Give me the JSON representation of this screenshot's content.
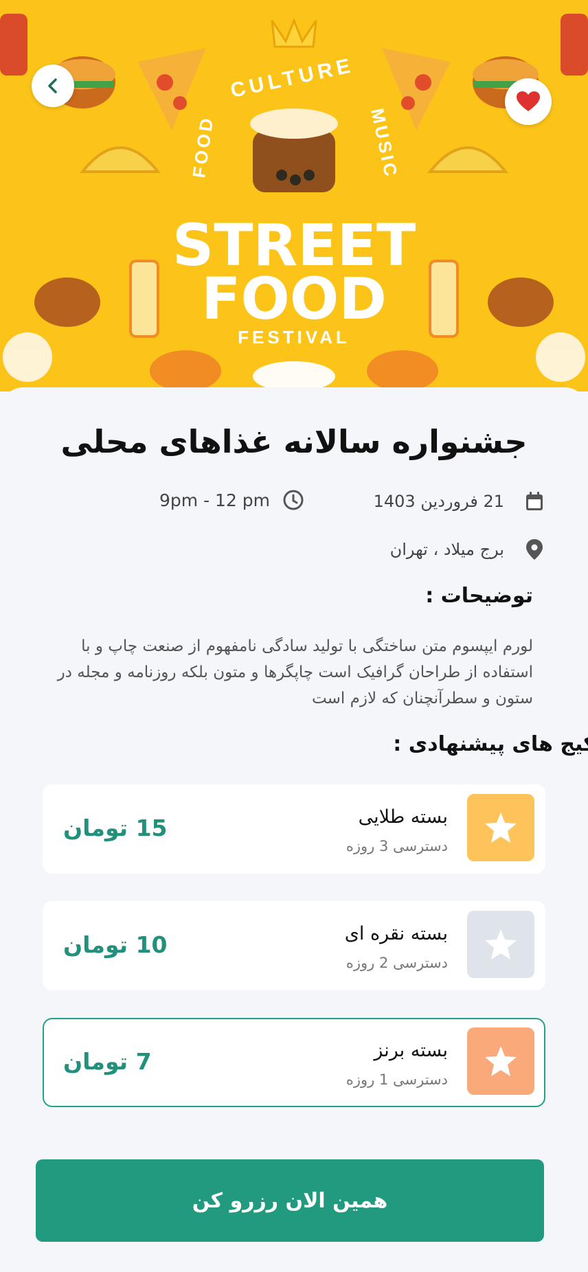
{
  "hero": {
    "banner_text": {
      "line1": "STREET",
      "line2": "FOOD",
      "line3": "FESTIVAL",
      "arc_left": "FOOD",
      "arc_top": "CULTURE",
      "arc_right": "MUSIC"
    },
    "colors": {
      "banner_bg": "#fcc419",
      "favorite": "#e03131"
    }
  },
  "event": {
    "title": "جشنواره سالانه غذاهای محلی",
    "date": "21 فروردین 1403",
    "time": "9pm - 12 pm",
    "location": "برج میلاد ، تهران"
  },
  "description": {
    "heading": "توضیحات :",
    "body": "لورم ایپسوم متن ساختگی با تولید سادگی نامفهوم از صنعت چاپ و با استفاده از طراحان گرافیک است چاپگرها و متون بلکه روزنامه و مجله در ستون و سطرآنچنان که لازم است"
  },
  "packages": {
    "heading": "پکیج های پیشنهادی :",
    "items": [
      {
        "name": "بسته طلایی",
        "access": "دسترسی 3 روزه",
        "price": "15 تومان",
        "color": "#ffc35b",
        "icon": "star-icon"
      },
      {
        "name": "بسته نقره ای",
        "access": "دسترسی 2 روزه",
        "price": "10 تومان",
        "color": "#dfe3ea",
        "icon": "star-icon"
      },
      {
        "name": "بسته برنز",
        "access": "دسترسی 1 روزه",
        "price": "7 تومان",
        "color": "#f9a97a",
        "icon": "star-icon",
        "selected": true
      }
    ]
  },
  "cta": {
    "label": "همین الان رزرو کن",
    "color": "#229a80"
  }
}
